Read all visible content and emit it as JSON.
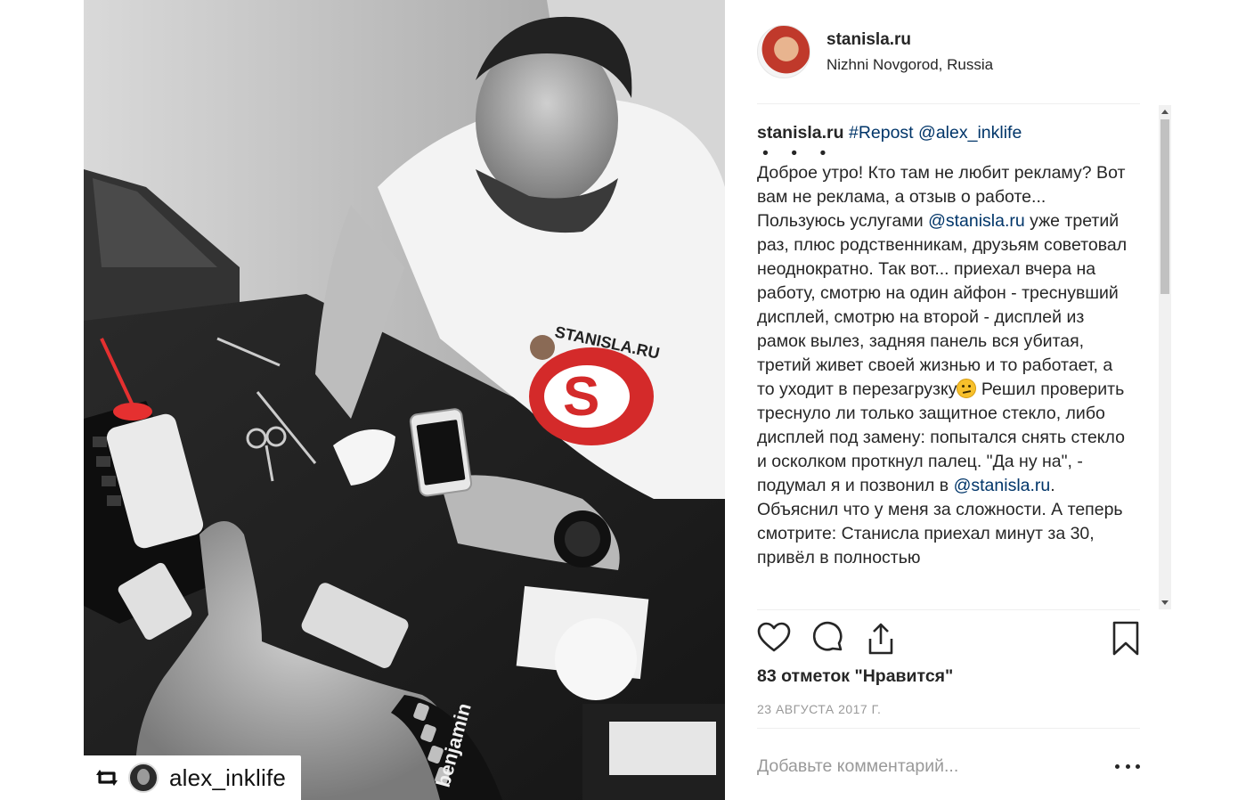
{
  "post": {
    "username": "stanisla.ru",
    "location": "Nizhni Novgorod, Russia",
    "avatar_icon": "user-avatar",
    "repost_username": "alex_inklife",
    "repost_icon": "repost-icon",
    "shirt_brand": "STANISLA.RU",
    "wristband_text": "benjamin"
  },
  "caption": {
    "author": "stanisla.ru",
    "hashtag_repost": "#Repost",
    "mention_source": "@alex_inklife",
    "dots": "• • •",
    "text_1": "Доброе утро! Кто там не любит рекламу? Вот вам не реклама, а отзыв о работе... Пользуюсь услугами ",
    "mention_1": "@stanisla.ru",
    "text_2": " уже третий раз, плюс родственникам, друзьям советовал неоднократно. Так вот... приехал вчера на работу, смотрю на один айфон - треснувший дисплей, смотрю на второй - дисплей из рамок вылез, задняя панель вся убитая, третий живет своей жизнью и то работает, а то уходит в перезагрузку",
    "emoji": "confused-face",
    "text_3": " Решил проверить треснуло ли только защитное стекло, либо дисплей под замену: попытался снять стекло и осколком проткнул палец. \"Да ну на\", - подумал я и позвонил в ",
    "mention_2": "@stanisla.ru",
    "text_4": ". Объяснил что у меня за сложности. А теперь смотрите: Станисла приехал минут за 30, привёл в полностью"
  },
  "actions": {
    "like_icon": "heart-icon",
    "comment_icon": "comment-icon",
    "share_icon": "share-icon",
    "save_icon": "bookmark-icon"
  },
  "likes_text": "83 отметок \"Нравится\"",
  "date_text": "23 АВГУСТА 2017 Г.",
  "comment": {
    "placeholder": "Добавьте комментарий...",
    "value": ""
  },
  "colors": {
    "text": "#262626",
    "link": "#003569",
    "muted": "#999999",
    "divider": "#efefef",
    "brand_red": "#d42a2a"
  }
}
